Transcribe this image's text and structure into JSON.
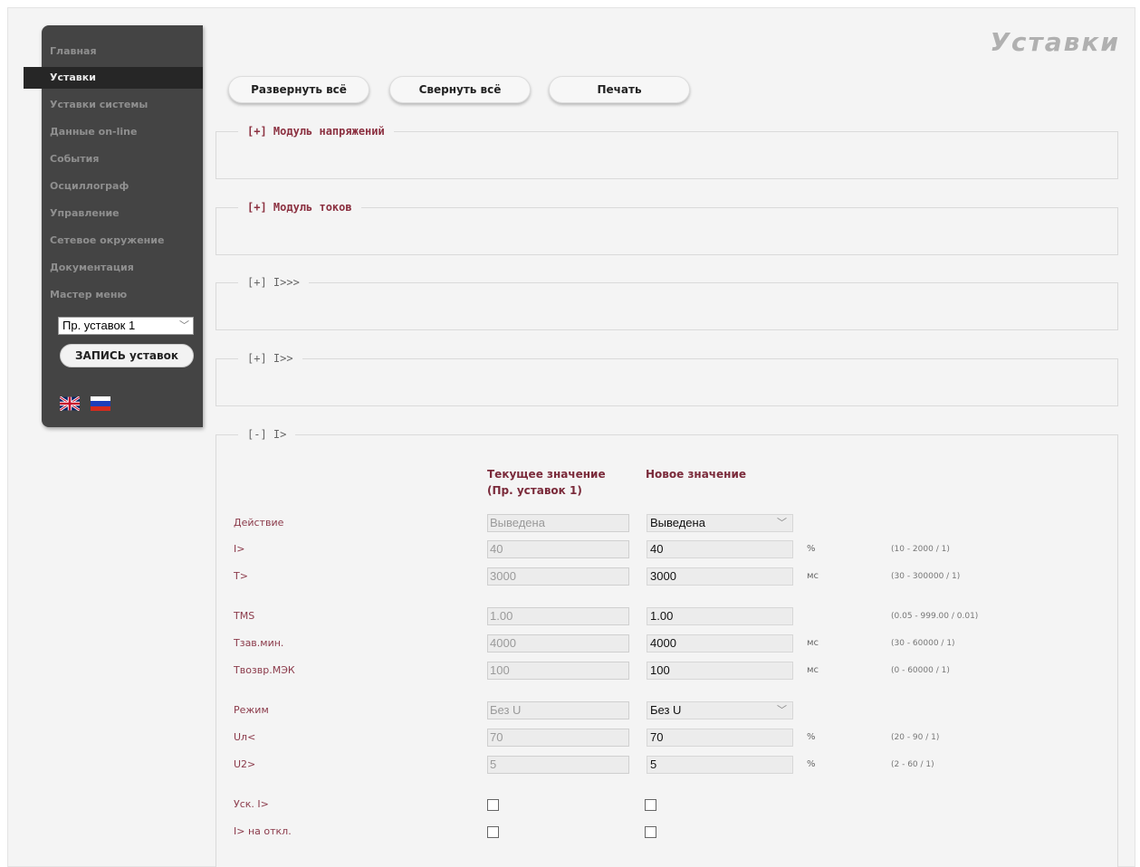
{
  "page_title": "Уставки",
  "sidebar": {
    "items": [
      {
        "label": "Главная"
      },
      {
        "label": "Уставки"
      },
      {
        "label": "Уставки системы"
      },
      {
        "label": "Данные on-line"
      },
      {
        "label": "События"
      },
      {
        "label": "Осциллограф"
      },
      {
        "label": "Управление"
      },
      {
        "label": "Сетевое окружение"
      },
      {
        "label": "Документация"
      },
      {
        "label": "Мастер меню"
      }
    ],
    "active_index": 1,
    "profile_select": "Пр. уставок 1",
    "save_button": "ЗАПИСЬ уставок"
  },
  "toolbar": {
    "expand_all": "Развернуть всё",
    "collapse_all": "Свернуть всё",
    "print": "Печать"
  },
  "sections": [
    {
      "legend": "[+] Модуль напряжений",
      "state": "collapsed"
    },
    {
      "legend": "[+] Модуль токов",
      "state": "collapsed"
    },
    {
      "legend": "[+] I>>>",
      "state": "collapsed"
    },
    {
      "legend": "[+] I>>",
      "state": "collapsed"
    },
    {
      "legend": "[-] I>",
      "state": "expanded"
    }
  ],
  "i_gt": {
    "col_current_line1": "Текущее значение",
    "col_current_line2": "(Пр. уставок 1)",
    "col_new": "Новое значение",
    "rows": [
      {
        "label": "Действие",
        "current": "Выведена",
        "new": "Выведена",
        "unit": "",
        "range": ""
      },
      {
        "label": "I>",
        "current": "40",
        "new": "40",
        "unit": "%",
        "range": "(10 - 2000 / 1)"
      },
      {
        "label": "T>",
        "current": "3000",
        "new": "3000",
        "unit": "мс",
        "range": "(30 - 300000 / 1)"
      },
      {
        "label": "TMS",
        "current": "1.00",
        "new": "1.00",
        "unit": "",
        "range": "(0.05 - 999.00 / 0.01)"
      },
      {
        "label": "Тзав.мин.",
        "current": "4000",
        "new": "4000",
        "unit": "мс",
        "range": "(30 - 60000 / 1)"
      },
      {
        "label": "Твозвр.МЭК",
        "current": "100",
        "new": "100",
        "unit": "мс",
        "range": "(0 - 60000 / 1)"
      },
      {
        "label": "Режим",
        "current": "Без U",
        "new": "Без U",
        "unit": "",
        "range": ""
      },
      {
        "label": "Uл<",
        "current": "70",
        "new": "70",
        "unit": "%",
        "range": "(20 - 90 / 1)"
      },
      {
        "label": "U2>",
        "current": "5",
        "new": "5",
        "unit": "%",
        "range": "(2 - 60 / 1)"
      },
      {
        "label": "Уск. I>",
        "current": false,
        "new": false
      },
      {
        "label": "I> на откл.",
        "current": false,
        "new": false
      }
    ]
  }
}
